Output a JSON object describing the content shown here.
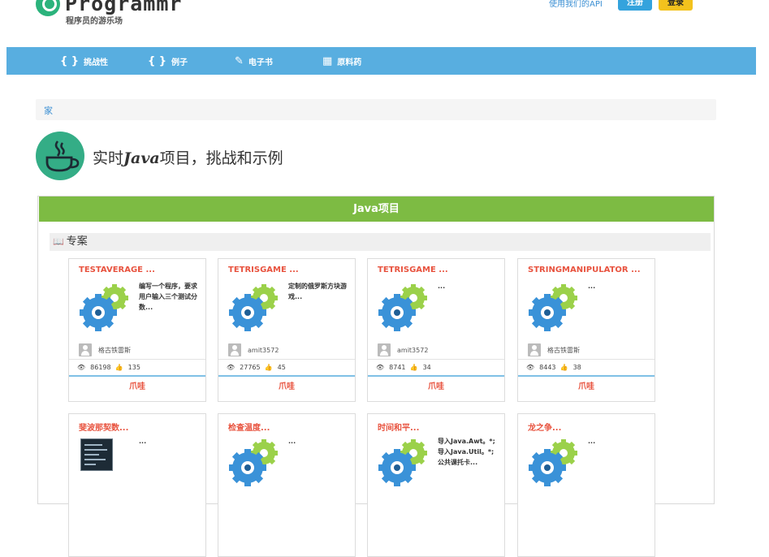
{
  "header": {
    "logo_text": "Programmr",
    "logo_subtitle": "程序员的游乐场",
    "api_link": "使用我们的API",
    "register_label": "注册",
    "login_label": "登录"
  },
  "nav": [
    {
      "icon": "{ }",
      "label": "挑战性"
    },
    {
      "icon": "{ }",
      "label": "例子"
    },
    {
      "icon": "✎",
      "label": "电子书"
    },
    {
      "icon": "▦",
      "label": "原料药"
    }
  ],
  "breadcrumb": {
    "home": "家"
  },
  "page_title": {
    "pre": "实时",
    "bold": "Java",
    "post": "项目，挑战和示例"
  },
  "panel": {
    "heading": "Java项目",
    "section": "专案"
  },
  "cards": [
    {
      "title": "TESTAVERAGE ...",
      "desc": "编写一个程序，要求用户输入三个测试分数...",
      "user": "格古铁雷斯",
      "views": "86198",
      "likes": "135",
      "action": "爪哇",
      "image": "gear-icon"
    },
    {
      "title": "TETRISGAME ...",
      "desc": "定制的俄罗斯方块游戏...",
      "user": "amit3572",
      "views": "27765",
      "likes": "45",
      "action": "爪哇",
      "image": "gear-icon"
    },
    {
      "title": "TETRISGAME ...",
      "desc": "...",
      "user": "amit3572",
      "views": "8741",
      "likes": "34",
      "action": "爪哇",
      "image": "gear-icon"
    },
    {
      "title": "STRINGMANIPULATOR ...",
      "desc": "...",
      "user": "格古铁雷斯",
      "views": "8443",
      "likes": "38",
      "action": "爪哇",
      "image": "gear-icon"
    },
    {
      "title": "斐波那契数...",
      "desc": "...",
      "image": "terminal-thumbnail"
    },
    {
      "title": "检查温度...",
      "desc": "...",
      "image": "gear-icon"
    },
    {
      "title": "时间和平...",
      "desc": "导入Java.Awt。*; 导入Java.Util。*; 公共课托卡...",
      "image": "gear-icon"
    },
    {
      "title": "龙之争...",
      "desc": "...",
      "image": "gear-icon"
    }
  ],
  "colors": {
    "nav_bg": "#58aee0",
    "panel_heading": "#7dbb43",
    "card_title": "#e8533f",
    "link": "#3b8fd3",
    "register": "#34a3dd",
    "login": "#f3c21d"
  }
}
